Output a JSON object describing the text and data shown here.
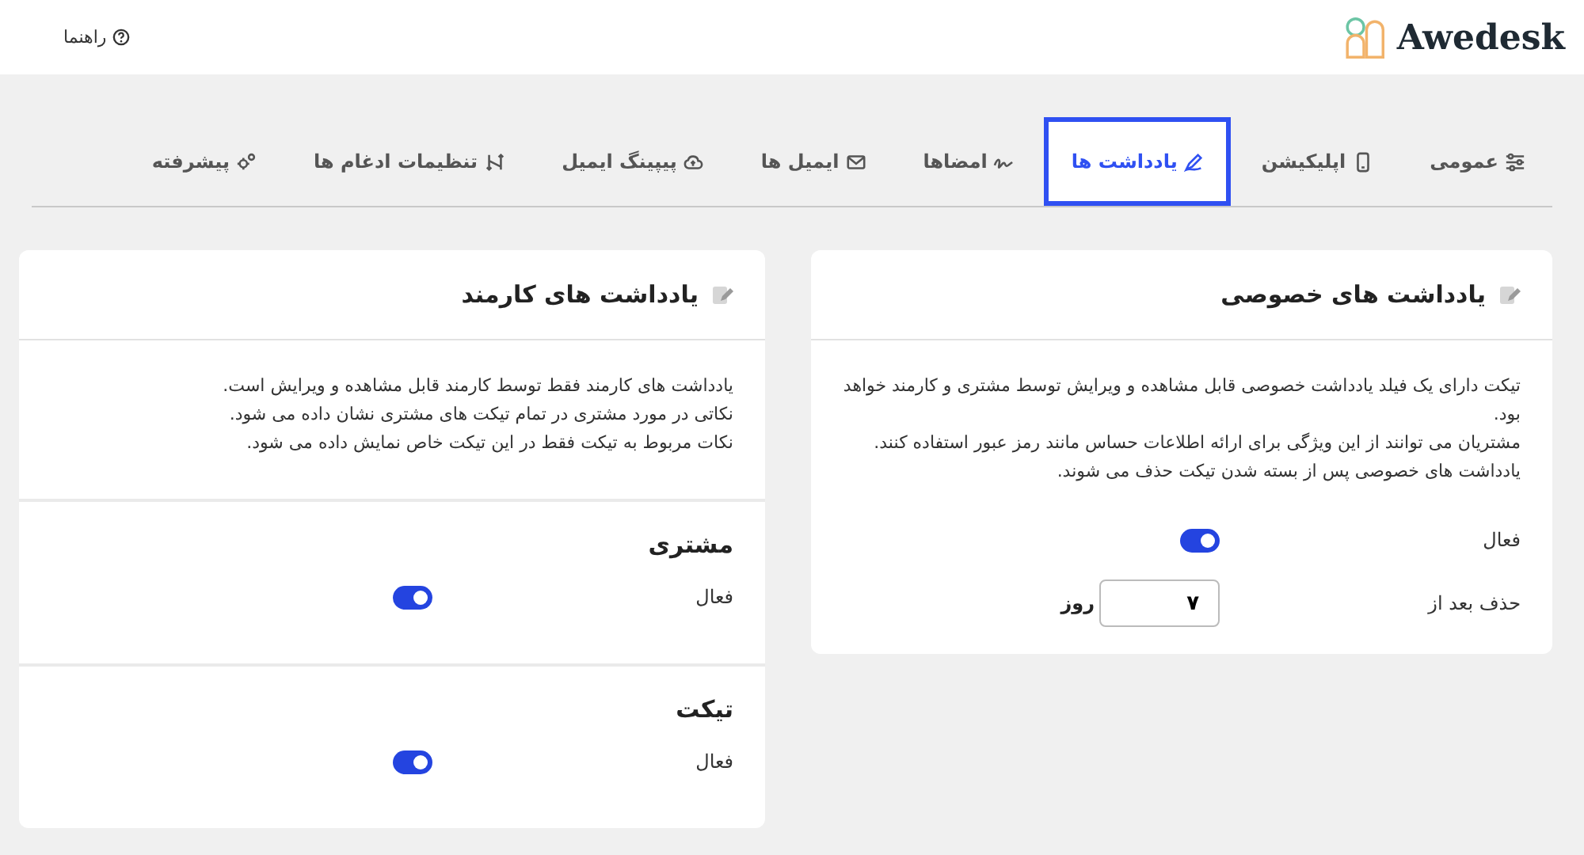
{
  "header": {
    "brand": "Awedesk",
    "help": "راهنما"
  },
  "tabs": [
    {
      "label": "عمومی",
      "selected": false
    },
    {
      "label": "اپلیکیشن",
      "selected": false
    },
    {
      "label": "یادداشت ها",
      "selected": true
    },
    {
      "label": "امضاها",
      "selected": false
    },
    {
      "label": "ایمیل ها",
      "selected": false
    },
    {
      "label": "پیپینگ ایمیل",
      "selected": false
    },
    {
      "label": "تنظیمات ادغام ها",
      "selected": false
    },
    {
      "label": "پیشرفته",
      "selected": false
    }
  ],
  "cards": [
    {
      "title": "یادداشت های خصوصی",
      "description": [
        "تیکت دارای یک فیلد یادداشت خصوصی قابل مشاهده و ویرایش توسط مشتری و کارمند خواهد بود.",
        "مشتریان می توانند از این ویژگی برای ارائه اطلاعات حساس مانند رمز عبور استفاده کنند.",
        "یادداشت های خصوصی پس از بسته شدن تیکت حذف می شوند."
      ],
      "settings": [
        {
          "kind": "toggle",
          "label": "فعال",
          "on": true
        },
        {
          "kind": "number",
          "label": "حذف بعد از",
          "value": "۷",
          "unit": "روز"
        }
      ]
    },
    {
      "title": "یادداشت های کارمند",
      "description": [
        "یادداشت های کارمند فقط توسط کارمند قابل مشاهده و ویرایش است.",
        "نکاتی در مورد مشتری در تمام تیکت های مشتری نشان داده می شود.",
        "نکات مربوط به تیکت فقط در این تیکت خاص نمایش داده می شود."
      ],
      "sections": [
        {
          "title": "مشتری",
          "settings": [
            {
              "kind": "toggle",
              "label": "فعال",
              "on": true
            }
          ]
        },
        {
          "title": "تیکت",
          "settings": [
            {
              "kind": "toggle",
              "label": "فعال",
              "on": true
            }
          ]
        }
      ]
    }
  ]
}
